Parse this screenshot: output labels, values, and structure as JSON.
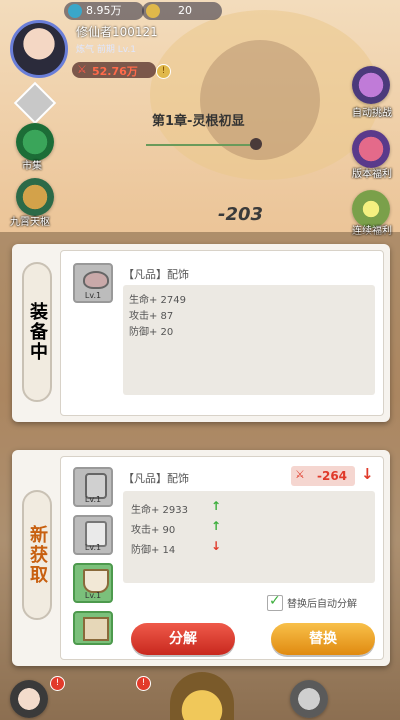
{
  "top_bar": {
    "res1": "8.95万",
    "res2": "20",
    "player_name": "修仙者100121",
    "realm": "炼气 前期",
    "realm_level": "Lv.1",
    "power": "52.76万"
  },
  "left_menu": [
    "市集",
    "九霄天枢"
  ],
  "right_menu": [
    "自动挑战",
    "版本福利",
    "连续福利"
  ],
  "chapter_title": "第1章-灵根初显",
  "damage_text": "-203",
  "equipped_panel": {
    "tab_label": "装备中",
    "quality": "【凡品】",
    "item_type": "配饰",
    "slot_level": "Lv.1",
    "stats": [
      "生命+ 2749",
      "攻击+ 87",
      "防御+ 20"
    ]
  },
  "new_panel": {
    "tab_label": "新获取",
    "quality": "【凡品】",
    "item_type": "配饰",
    "power_diff": "-264",
    "stats": [
      {
        "label": "生命+ 2933",
        "trend": "up"
      },
      {
        "label": "攻击+ 90",
        "trend": "up"
      },
      {
        "label": "防御+ 14",
        "trend": "down"
      }
    ],
    "slots": [
      "Lv.1",
      "Lv.1",
      "Lv.1",
      ""
    ],
    "auto_decompose_label": "替换后自动分解",
    "auto_decompose_checked": true,
    "decompose_button": "分解",
    "replace_button": "替换"
  },
  "colors": {
    "up": "#3cae3c",
    "down": "#e03a2a",
    "decompose": "#d9342b",
    "replace": "#f0a020"
  }
}
